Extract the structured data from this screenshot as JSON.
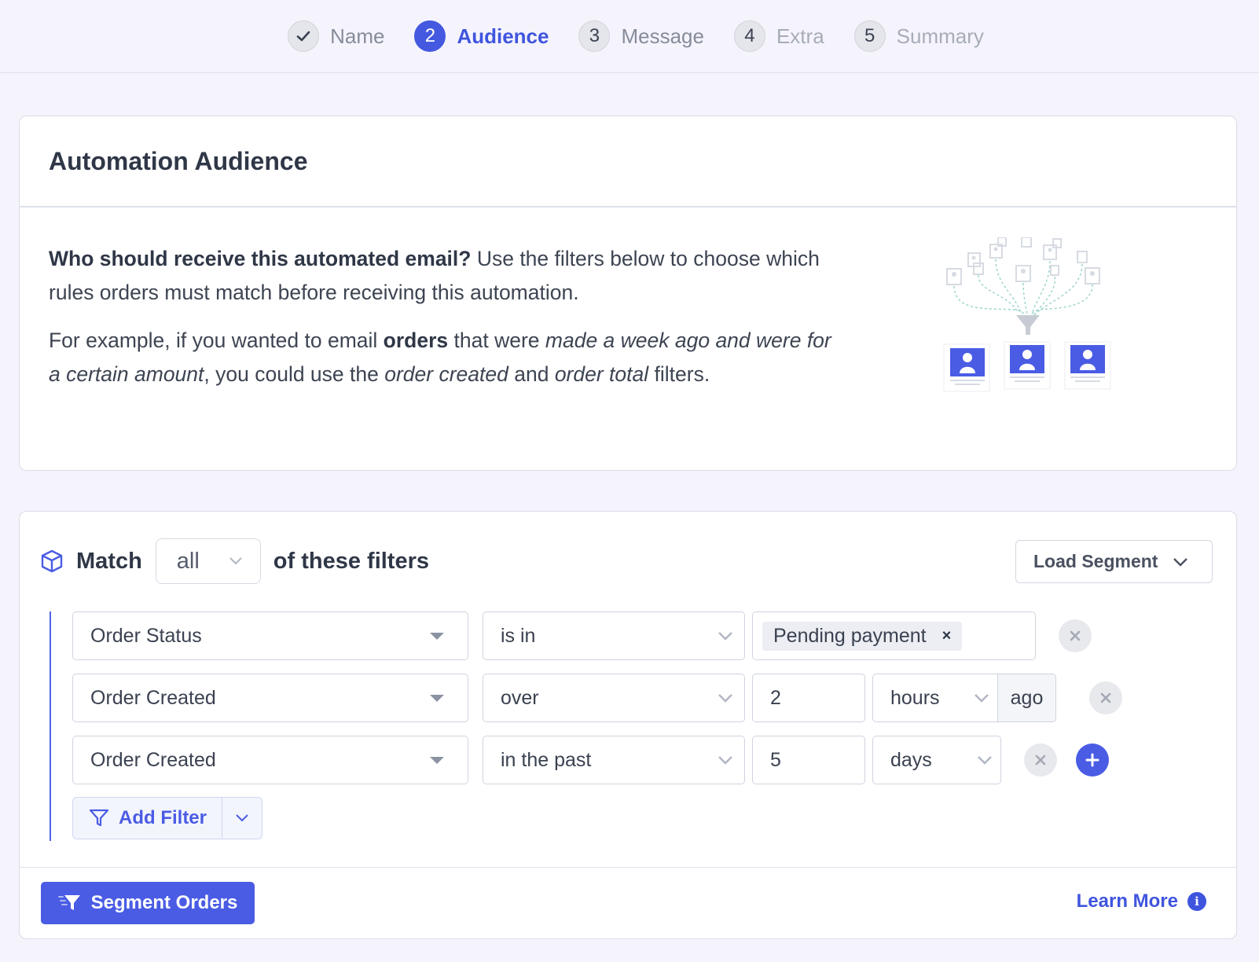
{
  "stepper": {
    "steps": [
      {
        "num": "✓",
        "label": "Name",
        "state": "done"
      },
      {
        "num": "2",
        "label": "Audience",
        "state": "active"
      },
      {
        "num": "3",
        "label": "Message",
        "state": "pending"
      },
      {
        "num": "4",
        "label": "Extra",
        "state": "muted"
      },
      {
        "num": "5",
        "label": "Summary",
        "state": "muted"
      }
    ]
  },
  "audience_card": {
    "title": "Automation Audience",
    "question": "Who should receive this automated email?",
    "question_rest": " Use the filters below to choose which rules orders must match before receiving this automation.",
    "example_1": "For example, if you wanted to email ",
    "example_orders": "orders",
    "example_2": " that were ",
    "example_italic_1": "made a week ago and were for a certain amount",
    "example_3": ", you could use the ",
    "example_italic_2": "order created",
    "example_4": " and ",
    "example_italic_3": "order total",
    "example_5": " filters."
  },
  "filters_card": {
    "match_label": "Match",
    "match_value": "all",
    "match_suffix": "of these filters",
    "load_segment": "Load Segment",
    "rows": [
      {
        "field": "Order Status",
        "operator": "is in",
        "tag": "Pending payment",
        "tag_remove": "×"
      },
      {
        "field": "Order Created",
        "operator": "over",
        "amount": "2",
        "unit": "hours",
        "suffix": "ago"
      },
      {
        "field": "Order Created",
        "operator": "in the past",
        "amount": "5",
        "unit": "days"
      }
    ],
    "add_filter": "Add Filter",
    "segment_button": "Segment Orders",
    "learn_more": "Learn More",
    "learn_more_icon": "i"
  },
  "colors": {
    "accent": "#4a5ce4",
    "background": "#f5f4fd"
  }
}
